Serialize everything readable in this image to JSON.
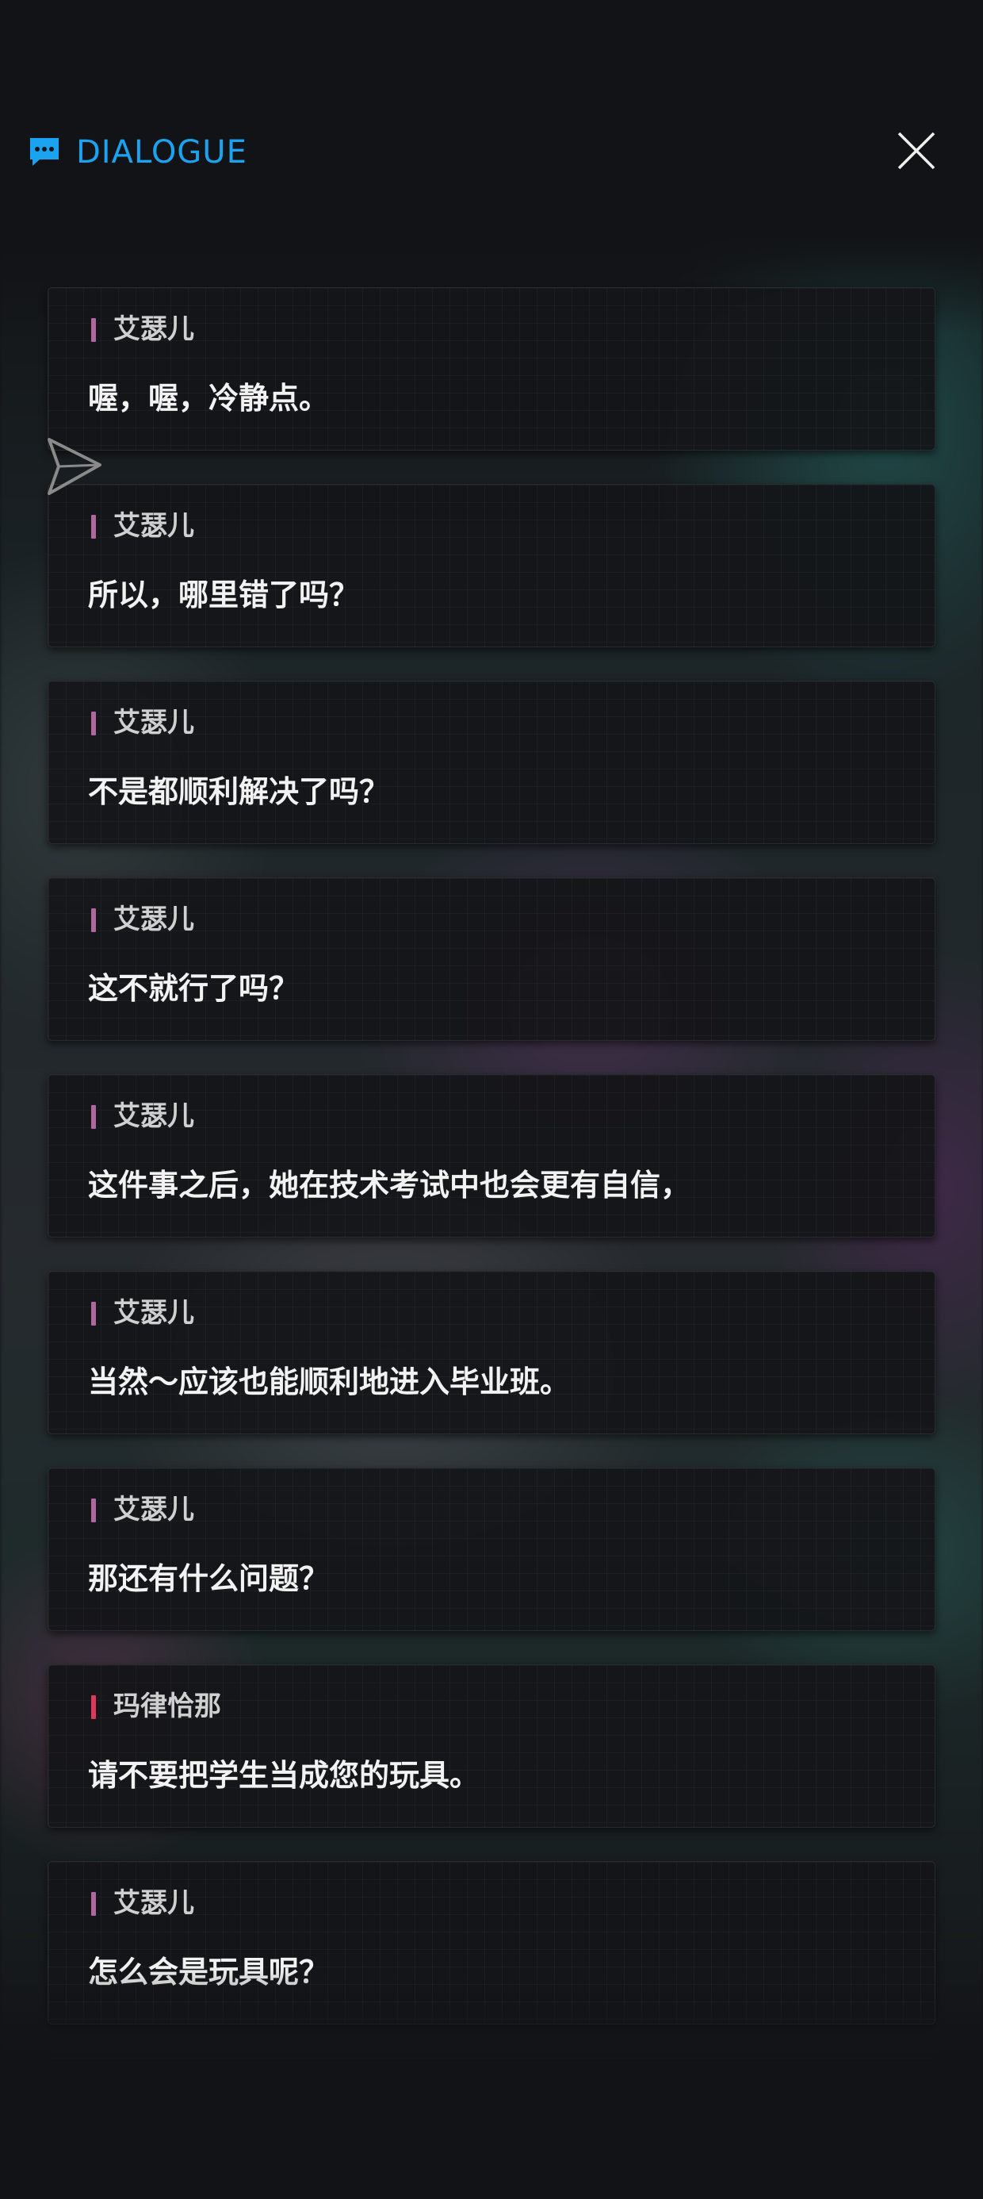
{
  "header": {
    "title": "DIALOGUE",
    "icon": "chat-bubble-icon",
    "close_icon": "close-icon",
    "accent_color": "#1aa3f0"
  },
  "speaker_colors": {
    "艾瑟儿": "#b0679f",
    "玛律恰那": "#e0365b"
  },
  "dialogue": [
    {
      "speaker": "艾瑟儿",
      "text": "喔，喔，冷静点。"
    },
    {
      "speaker": "艾瑟儿",
      "text": "所以，哪里错了吗？"
    },
    {
      "speaker": "艾瑟儿",
      "text": "不是都顺利解决了吗？"
    },
    {
      "speaker": "艾瑟儿",
      "text": "这不就行了吗？"
    },
    {
      "speaker": "艾瑟儿",
      "text": "这件事之后，她在技术考试中也会更有自信，"
    },
    {
      "speaker": "艾瑟儿",
      "text": "当然～应该也能顺利地进入毕业班。"
    },
    {
      "speaker": "艾瑟儿",
      "text": "那还有什么问题？"
    },
    {
      "speaker": "玛律恰那",
      "text": "请不要把学生当成您的玩具。"
    },
    {
      "speaker": "艾瑟儿",
      "text": "怎么会是玩具呢？"
    }
  ]
}
